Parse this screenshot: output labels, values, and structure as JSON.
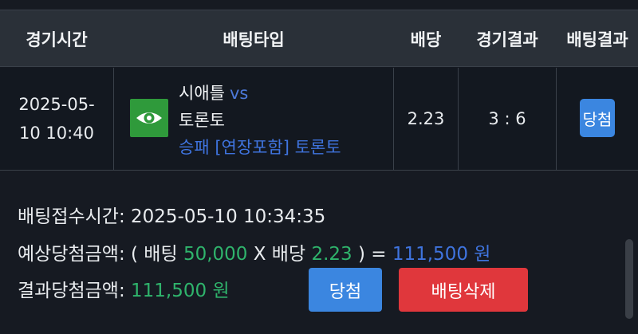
{
  "table": {
    "headers": {
      "game_time": "경기시간",
      "bet_type": "배팅타입",
      "odds": "배당",
      "game_result": "경기결과",
      "bet_result": "배팅결과"
    },
    "row": {
      "date": "2025-05-",
      "time": "10 10:40",
      "home_team": "시애틀",
      "vs": "vs",
      "away_team": "토론토",
      "bet_type": "승패 [연장포함] 토론토",
      "odds": "2.23",
      "score": "3 : 6",
      "result_badge": "당첨",
      "logo_icon": "eye-icon",
      "logo_color": "#2f9a3b"
    }
  },
  "details": {
    "receipt_label": "배팅접수시간: ",
    "receipt_time": "2025-05-10 10:34:35",
    "expected_label": "예상당첨금액: ( 배팅 ",
    "bet_amount": "50,000",
    "x_sep": " X 배당 ",
    "odds": "2.23",
    "eq_sep": " ) = ",
    "expected_amount": "111,500 원",
    "result_label": "결과당첨금액: ",
    "result_amount": "111,500 원"
  },
  "actions": {
    "win_button": "당첨",
    "delete_button": "배팅삭제"
  },
  "colors": {
    "accent_blue": "#3b86e0",
    "delete_red": "#e0373c",
    "amount_green": "#2fb46c"
  }
}
